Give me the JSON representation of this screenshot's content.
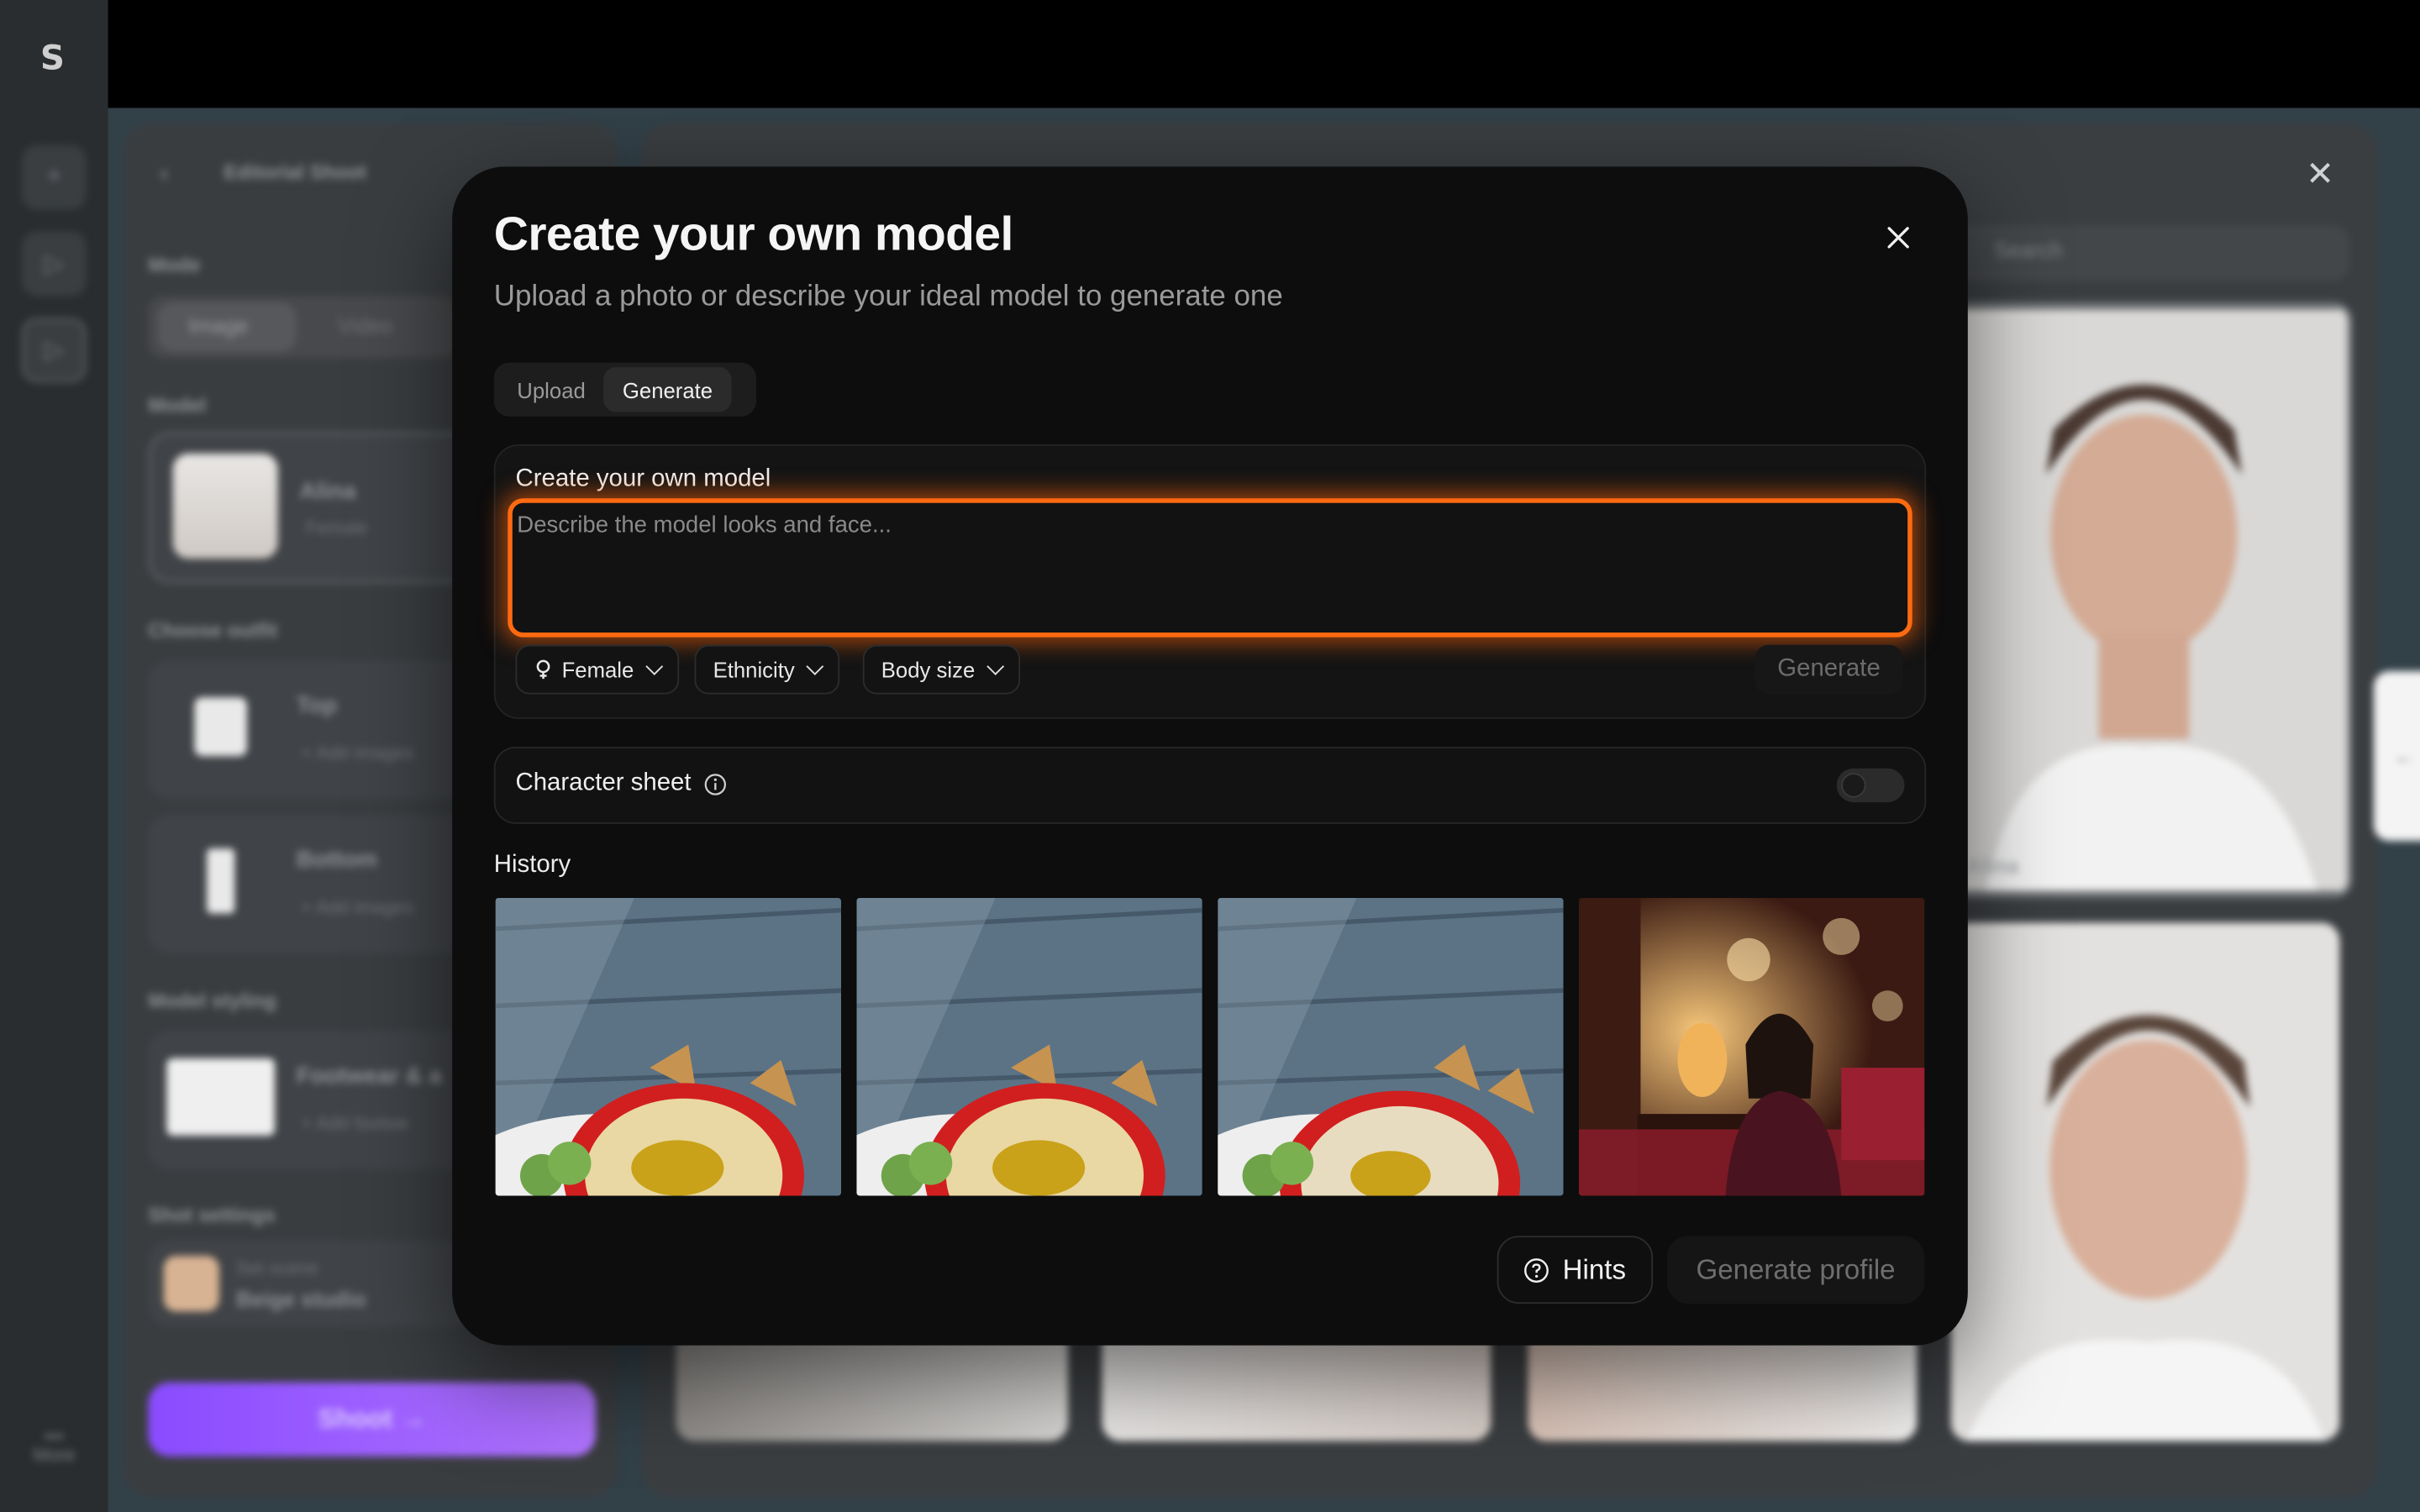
{
  "background": {
    "rail": {
      "logo": "S",
      "more_label": "More"
    },
    "left_panel": {
      "project_title": "Editorial Shoot",
      "mode_label": "Mode",
      "mode_tabs": [
        "Image",
        "Video"
      ],
      "model_label": "Model",
      "model_name": "Alina",
      "model_gender": "Female",
      "outfit_label": "Choose outfit",
      "outfit_items": [
        {
          "title": "Top",
          "action": "+ Add images"
        },
        {
          "title": "Bottom",
          "action": "+ Add images"
        }
      ],
      "styling_label": "Model styling",
      "styling_item": {
        "title": "Footwear & a",
        "action": "+ Add footwe"
      },
      "shot_settings_label": "Shot settings",
      "scene_caption": "Set scene",
      "scene_value": "Beige studio",
      "shoot_button": "Shoot →"
    },
    "right_panel": {
      "search_placeholder": "Search",
      "selected_model_name": "Alina"
    }
  },
  "modal": {
    "title": "Create your own model",
    "subtitle": "Upload a photo or describe your ideal model to generate one",
    "tabs": [
      {
        "label": "Upload",
        "active": false
      },
      {
        "label": "Generate",
        "active": true
      }
    ],
    "generator": {
      "label": "Create your own model",
      "placeholder": "Describe the model looks and face...",
      "value": "",
      "filters": [
        {
          "label": "Female",
          "icon": "female-icon"
        },
        {
          "label": "Ethnicity"
        },
        {
          "label": "Body size"
        }
      ],
      "generate_button": "Generate"
    },
    "character_sheet": {
      "label": "Character sheet",
      "enabled": false
    },
    "history": {
      "label": "History",
      "items": [
        {
          "subject": "hummus bowl"
        },
        {
          "subject": "hummus bowl"
        },
        {
          "subject": "hummus bowl"
        },
        {
          "subject": "woman in bedroom"
        }
      ]
    },
    "footer": {
      "hints_button": "Hints",
      "generate_profile_button": "Generate profile"
    }
  },
  "colors": {
    "accent_glow": "#ff6a10",
    "shoot_purple": "#8a4bff",
    "modal_bg": "#0d0d0d"
  }
}
